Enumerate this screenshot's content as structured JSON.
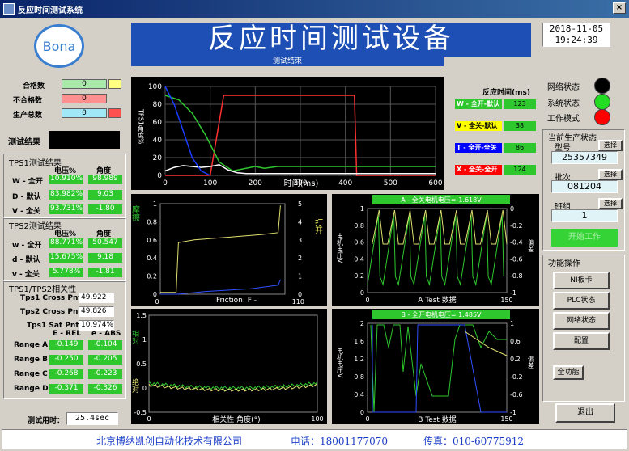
{
  "window": {
    "title": "反应时间测试系统"
  },
  "header": {
    "logo_text": "Bona",
    "main_title": "反应时间测试设备",
    "status_text": "测试结束",
    "date": "2018-11-05",
    "time": "19:24:39"
  },
  "counts": {
    "pass_label": "合格数",
    "pass_value": "0",
    "fail_label": "不合格数",
    "fail_value": "0",
    "total_label": "生产总数",
    "total_value": "0"
  },
  "result": {
    "label": "测试结果"
  },
  "tps1": {
    "title": "TPS1测试结果",
    "col1": "电压%",
    "col2": "角度",
    "rows": [
      {
        "name": "W - 全开",
        "v1": "10.910%",
        "v2": "98.989"
      },
      {
        "name": "D - 默认",
        "v1": "83.982%",
        "v2": "9.03"
      },
      {
        "name": "V - 全关",
        "v1": "93.731%",
        "v2": "-1.80"
      }
    ]
  },
  "tps2": {
    "title": "TPS2测试结果",
    "col1": "电压%",
    "col2": "角度",
    "rows": [
      {
        "name": "w - 全开",
        "v1": "88.771%",
        "v2": "50.547"
      },
      {
        "name": "d - 默认",
        "v1": "15.675%",
        "v2": "9.18"
      },
      {
        "name": "v - 全关",
        "v1": "5.778%",
        "v2": "-1.81"
      }
    ]
  },
  "corr": {
    "title": "TPS1/TPS2相关性",
    "cross1_label": "Tps1 Cross Pnt",
    "cross1_value": "49.922",
    "cross2_label": "Tps2 Cross Pnt",
    "cross2_value": "49.826",
    "sat_label": "Tps1 Sat Pnt",
    "sat_value": "10.974%",
    "col1": "E - REL",
    "col2": "e - ABS",
    "rows": [
      {
        "name": "Range A",
        "v1": "-0.149",
        "v2": "-0.104"
      },
      {
        "name": "Range B",
        "v1": "-0.250",
        "v2": "-0.205"
      },
      {
        "name": "Range C",
        "v1": "-0.268",
        "v2": "-0.223"
      },
      {
        "name": "Range D",
        "v1": "-0.371",
        "v2": "-0.326"
      }
    ]
  },
  "test_time": {
    "label": "测试用时：",
    "value": "25.4sec"
  },
  "reaction": {
    "title": "反应时间(ms)",
    "rows": [
      {
        "name": "W - 全开-默认",
        "value": "123",
        "color": "#2ec72e"
      },
      {
        "name": "V - 全关-默认",
        "value": "38",
        "color": "#ffff00"
      },
      {
        "name": "T - 全开-全关",
        "value": "86",
        "color": "#0000ff"
      },
      {
        "name": "X - 全关-全开",
        "value": "124",
        "color": "#ff0000"
      }
    ]
  },
  "status": {
    "network_label": "网络状态",
    "network_color": "#000000",
    "system_label": "系统状态",
    "system_color": "#22dd22",
    "mode_label": "工作模式",
    "mode_color": "#ff0000"
  },
  "production": {
    "title": "当前生产状态",
    "model_label": "型号",
    "model_value": "25357349",
    "batch_label": "批次",
    "batch_value": "081204",
    "shift_label": "班组",
    "shift_value": "1",
    "select_label": "选择",
    "start_label": "开始工作"
  },
  "functions": {
    "title": "功能操作",
    "buttons": [
      "NI板卡",
      "PLC状态",
      "网络状态",
      "配置"
    ],
    "all_label": "全功能",
    "exit_label": "退出"
  },
  "footer": {
    "company": "北京博纳凯创自动化技术有限公司",
    "phone": "电话：18001177070",
    "fax": "传真：010-60775912"
  },
  "chart_data": [
    {
      "type": "line",
      "ylabel": "TPS1角度%",
      "xlabel": "时间(ms)",
      "x_ticks": [
        "0",
        "100",
        "200",
        "300",
        "400",
        "500",
        "600"
      ],
      "y_ticks": [
        "0",
        "20",
        "40",
        "60",
        "80",
        "100"
      ],
      "xlim": [
        0,
        600
      ],
      "ylim": [
        0,
        100
      ],
      "series": [
        {
          "color": "#ff3030",
          "x": [
            0,
            10,
            40,
            100,
            130,
            200,
            420,
            425,
            600
          ],
          "y": [
            0,
            0,
            0,
            0,
            90,
            90,
            90,
            0,
            0
          ]
        },
        {
          "color": "#2ec72e",
          "x": [
            0,
            30,
            60,
            90,
            120,
            150,
            200,
            220,
            250,
            300,
            350,
            420,
            520,
            600
          ],
          "y": [
            90,
            85,
            70,
            45,
            15,
            5,
            10,
            8,
            10,
            10,
            10,
            10,
            10,
            10
          ]
        },
        {
          "color": "#ffffff",
          "x": [
            0,
            20,
            40,
            60,
            80,
            100,
            120,
            140,
            160,
            180,
            200,
            240,
            320,
            600
          ],
          "y": [
            5,
            9,
            11,
            10,
            9,
            10,
            12,
            6,
            3,
            2,
            2,
            2,
            2,
            2
          ]
        },
        {
          "color": "#1a3cff",
          "x": [
            0,
            20,
            40,
            60,
            80,
            100
          ],
          "y": [
            100,
            80,
            50,
            20,
            5,
            0
          ]
        }
      ]
    },
    {
      "type": "line",
      "ylabel_left": "摩擦",
      "ylabel_right": "打开",
      "xlabel": "Friction: F -",
      "x_ticks": [
        "0",
        "110"
      ],
      "y_ticks_left": [
        "0",
        "0.2",
        "0.4",
        "0.6",
        "0.8",
        "1"
      ],
      "y_ticks_right": [
        "0",
        "1",
        "2",
        "3",
        "4",
        "5"
      ],
      "xlim": [
        0,
        110
      ],
      "ylim": [
        0,
        1
      ],
      "series": [
        {
          "color": "#e0e070",
          "x": [
            0,
            14,
            16,
            30,
            60,
            90,
            104,
            106
          ],
          "y": [
            0.02,
            0.02,
            0.57,
            0.6,
            0.63,
            0.66,
            0.68,
            0.98
          ]
        },
        {
          "color": "#3050ff",
          "x": [
            0,
            15,
            40,
            80,
            104,
            106
          ],
          "y": [
            0,
            0,
            0.03,
            0.06,
            0.1,
            0.16
          ]
        }
      ]
    },
    {
      "type": "line",
      "title": "A - 全关电机电压=-1.618V",
      "ylabel_left": "电机电压V",
      "ylabel_right": "偏差",
      "xlabel": "A Test 数据",
      "x_ticks": [
        "0",
        "150"
      ],
      "y_ticks_left": [
        "0",
        "0.2",
        "0.4",
        "0.6",
        "0.8",
        "1"
      ],
      "y_ticks_right": [
        "-1",
        "-0.8",
        "-0.6",
        "-0.4",
        "-0.2",
        "0"
      ],
      "xlim": [
        0,
        150
      ],
      "ylim": [
        0,
        1
      ]
    },
    {
      "type": "line",
      "ylabel_left": "相对",
      "ylabel_left2": "绝对",
      "xlabel": "相关性 角度(°)",
      "x_ticks": [
        "0",
        "100"
      ],
      "y_ticks": [
        "-0.5",
        "0",
        "0.5",
        "1",
        "1.5"
      ],
      "xlim": [
        0,
        100
      ],
      "ylim": [
        -0.5,
        1.5
      ]
    },
    {
      "type": "line",
      "title": "B - 全开电机电压= 1.485V",
      "ylabel_left": "电机电压V",
      "ylabel_right": "偏差",
      "xlabel": "B Test 数据",
      "x_ticks": [
        "0",
        "150"
      ],
      "y_ticks_left": [
        "0",
        "0.4",
        "0.8",
        "1.2",
        "1.6",
        "2"
      ],
      "y_ticks_right": [
        "-1",
        "-0.6",
        "-0.2",
        "0.2",
        "0.6",
        "1"
      ],
      "xlim": [
        0,
        150
      ],
      "ylim": [
        0,
        2
      ]
    }
  ]
}
